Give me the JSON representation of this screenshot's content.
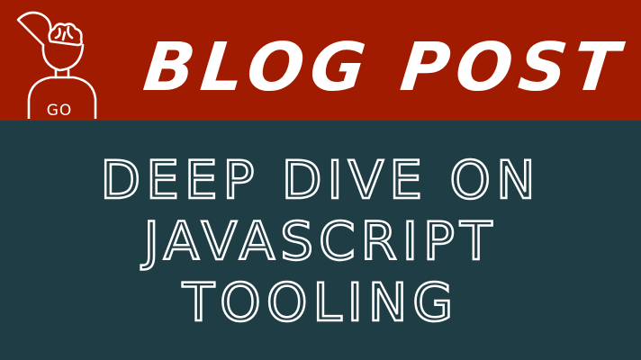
{
  "colors": {
    "header_background": "#a11b00",
    "body_background": "#1f3d44",
    "text": "#ffffff"
  },
  "logo": {
    "icon": "brain-person-icon",
    "text": "GO"
  },
  "header": {
    "label": "BLOG POST"
  },
  "title": {
    "lines": [
      "DEEP DIVE ON",
      "JAVASCRIPT",
      "TOOLING"
    ]
  }
}
